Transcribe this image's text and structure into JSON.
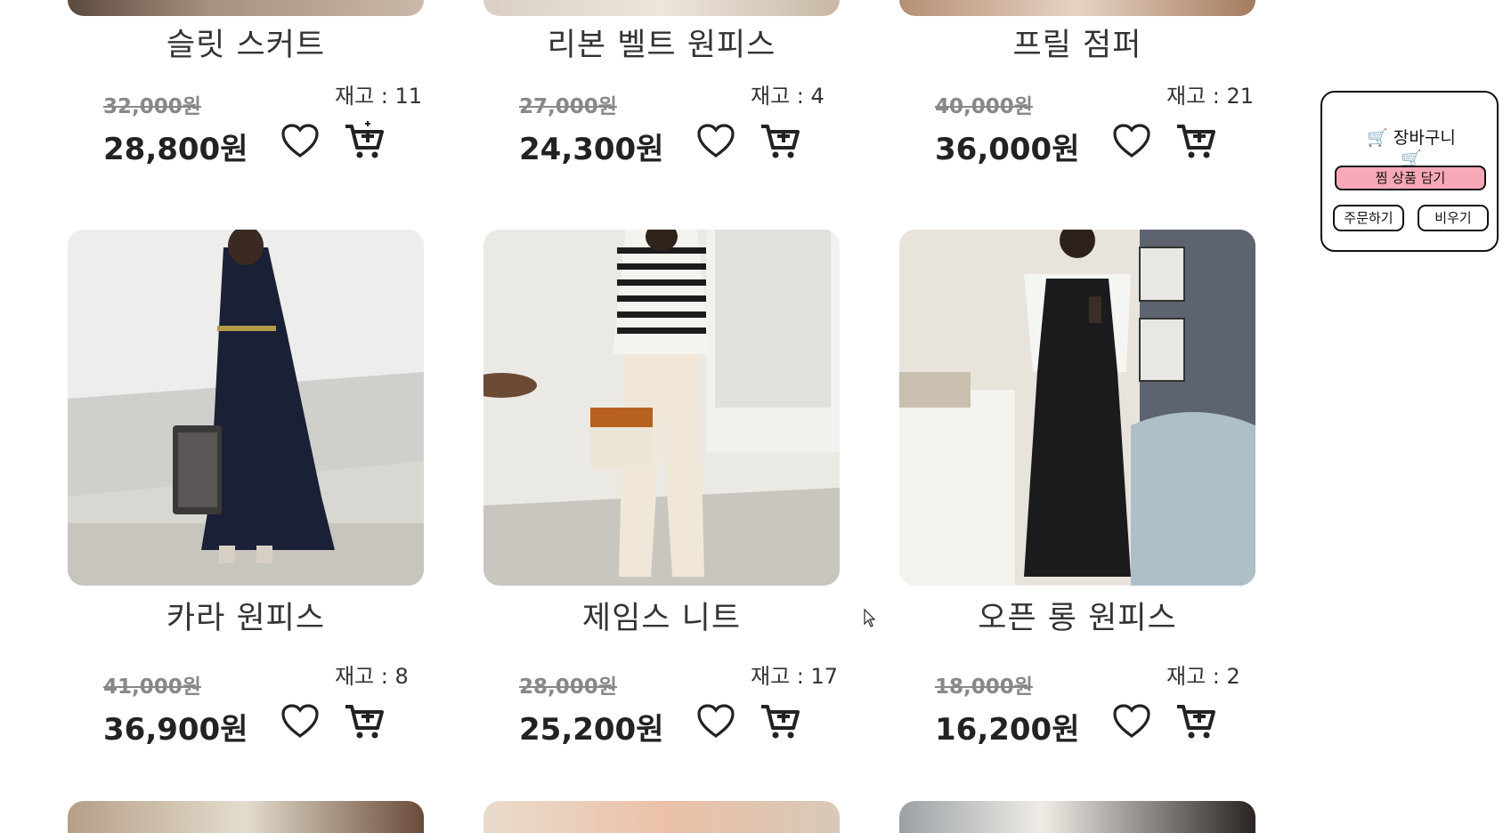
{
  "top_row": [
    {
      "name": "슬릿 스커트",
      "original_price": "32,000원",
      "sale_price": "28,800원",
      "stock": "재고 : 11"
    },
    {
      "name": "리본 벨트 원피스",
      "original_price": "27,000원",
      "sale_price": "24,300원",
      "stock": "재고 : 4"
    },
    {
      "name": "프릴 점퍼",
      "original_price": "40,000원",
      "sale_price": "36,000원",
      "stock": "재고 : 21"
    }
  ],
  "middle_row": [
    {
      "name": "카라 원피스",
      "original_price": "41,000원",
      "sale_price": "36,900원",
      "stock": "재고 : 8"
    },
    {
      "name": "제임스 니트",
      "original_price": "28,000원",
      "sale_price": "25,200원",
      "stock": "재고 : 17"
    },
    {
      "name": "오픈 롱 원피스",
      "original_price": "18,000원",
      "sale_price": "16,200원",
      "stock": "재고 : 2"
    }
  ],
  "cart_panel": {
    "title": "🛒 장바구니 🛒",
    "wish_button": "찜 상품 담기",
    "order_button": "주문하기",
    "clear_button": "비우기"
  },
  "icons": {
    "heart": "heart-icon",
    "cart": "cart-plus-icon",
    "cart_small": "cart-icon"
  },
  "colors": {
    "wish_button_bg": "#f8a8b8",
    "text": "#222222"
  }
}
